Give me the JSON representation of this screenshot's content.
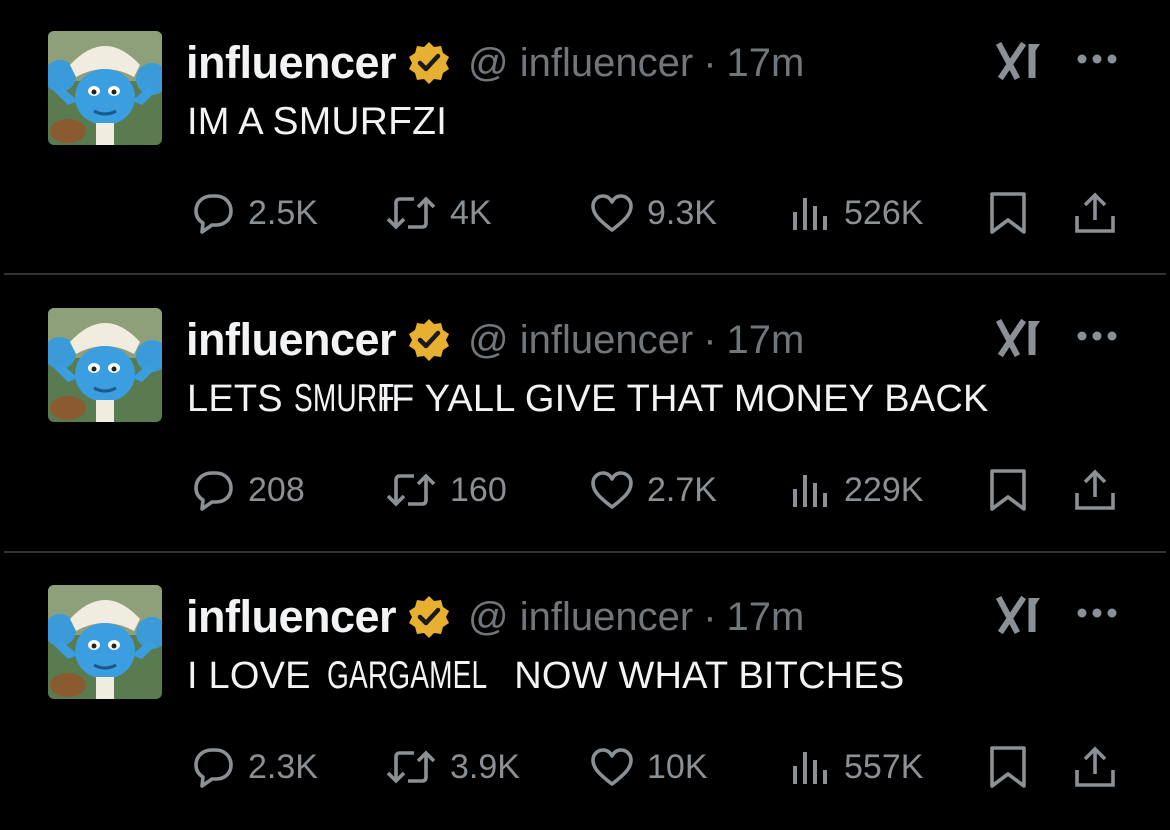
{
  "tweets": [
    {
      "name": "influencer",
      "handle": "@ influencer",
      "separator": "·",
      "time": "17m",
      "text_parts": [
        "IM A ",
        "SMURFZI"
      ],
      "replies": "2.5K",
      "retweets": "4K",
      "likes": "9.3K",
      "views": "526K"
    },
    {
      "name": "influencer",
      "handle": "@ influencer",
      "separator": "·",
      "time": "17m",
      "text_parts": [
        "LETS ",
        "SMURF",
        " IF YALL GIVE THAT MONEY BACK"
      ],
      "replies": "208",
      "retweets": "160",
      "likes": "2.7K",
      "views": "229K"
    },
    {
      "name": "influencer",
      "handle": "@ influencer",
      "separator": "·",
      "time": "17m",
      "text_parts": [
        "I LOVE ",
        "GARGAMEL",
        " NOW WHAT BITCHES"
      ],
      "replies": "2.3K",
      "retweets": "3.9K",
      "likes": "10K",
      "views": "557K"
    }
  ],
  "icons": {
    "avatar": "smurf-avatar",
    "verified": "verified-badge-icon",
    "grok": "grok-icon",
    "more": "more-dots-icon",
    "reply": "reply-bubble-icon",
    "retweet": "retweet-icon",
    "like": "heart-icon",
    "views": "views-bars-icon",
    "bookmark": "bookmark-icon",
    "share": "share-icon"
  },
  "colors": {
    "background": "#000000",
    "text": "#e7e9ea",
    "muted": "#71767b",
    "verified_gold": "#e8b031",
    "divider": "#2f3336"
  }
}
